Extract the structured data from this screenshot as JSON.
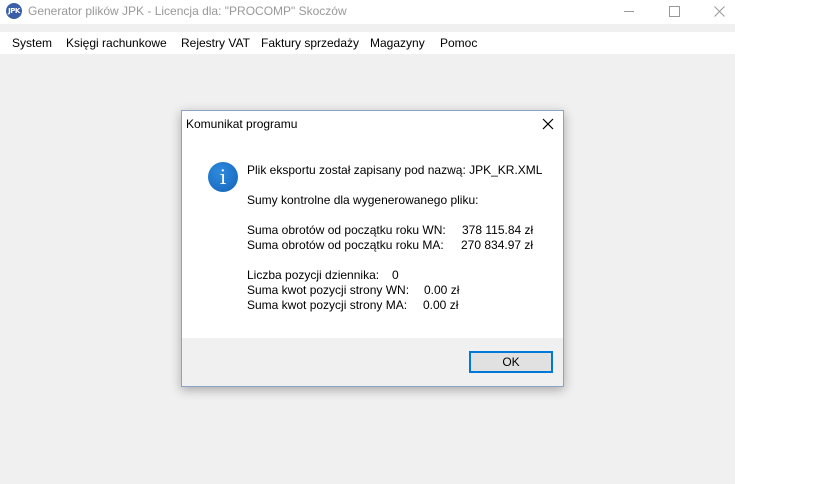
{
  "window": {
    "icon_text": "JPK",
    "title": "Generator plików JPK - Licencja dla: \"PROCOMP\" Skoczów"
  },
  "menu": {
    "items": [
      "System",
      "Księgi rachunkowe",
      "Rejestry VAT",
      "Faktury sprzedaży",
      "Magazyny",
      "Pomoc"
    ]
  },
  "dialog": {
    "title": "Komunikat programu",
    "export_msg": "Plik eksportu został zapisany pod nazwą: JPK_KR.XML",
    "checksum_header": "Sumy kontrolne dla wygenerowanego pliku:",
    "turnover_wn_label": "Suma obrotów od początku roku WN:",
    "turnover_wn_value": "378 115.84 zł",
    "turnover_ma_label": "Suma obrotów od początku roku MA:",
    "turnover_ma_value": "270 834.97 zł",
    "entries_label": "Liczba pozycji dziennika:",
    "entries_value": "0",
    "wn_items_label": "Suma kwot pozycji strony WN:",
    "wn_items_value": "0.00 zł",
    "ma_items_label": "Suma kwot pozycji strony MA:",
    "ma_items_value": "0.00 zł",
    "ok_label": "OK",
    "icon": "info-icon"
  }
}
